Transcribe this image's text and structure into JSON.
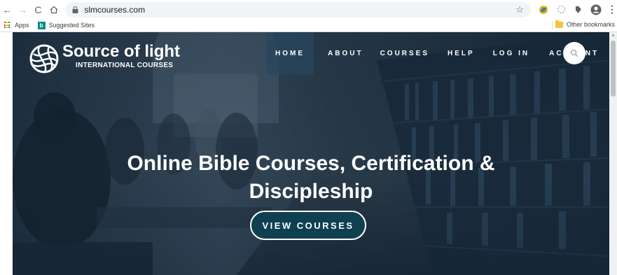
{
  "browser": {
    "url": "slmcourses.com",
    "bookmarks": {
      "apps_label": "Apps",
      "suggested_label": "Suggested Sites",
      "other_label": "Other bookmarks"
    }
  },
  "site": {
    "logo_title": "Source of light",
    "logo_subtitle": "INTERNATIONAL COURSES",
    "nav": {
      "home": "HOME",
      "about": "ABOUT",
      "courses": "COURSES",
      "help": "HELP",
      "login": "LOG IN",
      "account": "ACCOUNT"
    },
    "headline_line1": "Online Bible Courses, Certification &",
    "headline_line2": "Discipleship",
    "cta_label": "VIEW COURSES"
  },
  "colors": {
    "hero_overlay": "#102030",
    "cta_background": "#0f4052",
    "active_nav": "#28465f"
  }
}
